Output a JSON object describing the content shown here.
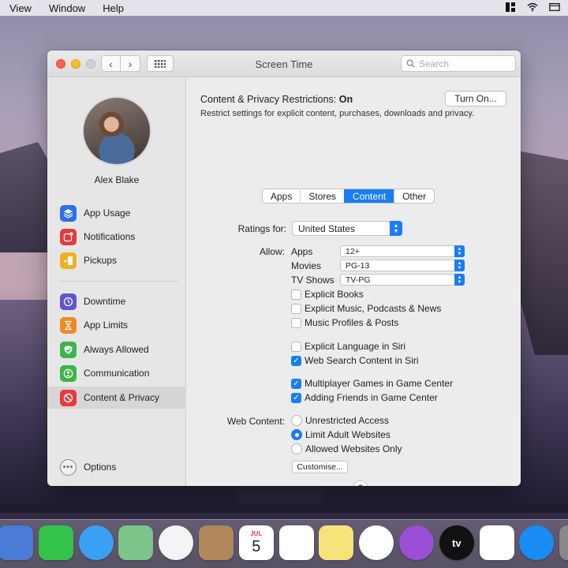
{
  "menubar": {
    "items": [
      "View",
      "Window",
      "Help"
    ]
  },
  "window": {
    "title": "Screen Time",
    "search_placeholder": "Search"
  },
  "sidebar": {
    "user_name": "Alex Blake",
    "items": [
      {
        "label": "App Usage",
        "icon": "stack-icon",
        "color": "#2c6fe8"
      },
      {
        "label": "Notifications",
        "icon": "notification-badge-icon",
        "color": "#e63b3b"
      },
      {
        "label": "Pickups",
        "icon": "phone-pickup-icon",
        "color": "#f0b022"
      },
      {
        "label": "Downtime",
        "icon": "moon-clock-icon",
        "color": "#6155cf"
      },
      {
        "label": "App Limits",
        "icon": "hourglass-icon",
        "color": "#f08a24"
      },
      {
        "label": "Always Allowed",
        "icon": "checkmark-shield-icon",
        "color": "#3bb54a"
      },
      {
        "label": "Communication",
        "icon": "person-circle-icon",
        "color": "#3bb54a"
      },
      {
        "label": "Content & Privacy",
        "icon": "no-entry-icon",
        "color": "#e63b3b"
      }
    ],
    "options_label": "Options"
  },
  "main": {
    "restrictions_label": "Content & Privacy Restrictions:",
    "restrictions_state": "On",
    "restrictions_desc": "Restrict settings for explicit content, purchases, downloads and privacy.",
    "turn_on_label": "Turn On...",
    "tabs": [
      "Apps",
      "Stores",
      "Content",
      "Other"
    ],
    "selected_tab": "Content",
    "ratings_label": "Ratings for:",
    "ratings_value": "United States",
    "allow_label": "Allow:",
    "allow_rows": [
      {
        "label": "Apps",
        "value": "12+"
      },
      {
        "label": "Movies",
        "value": "PG-13"
      },
      {
        "label": "TV Shows",
        "value": "TV-PG"
      }
    ],
    "checkboxes": [
      {
        "label": "Explicit Books",
        "checked": false
      },
      {
        "label": "Explicit Music, Podcasts & News",
        "checked": false
      },
      {
        "label": "Music Profiles & Posts",
        "checked": false
      },
      {
        "label": "Explicit Language in Siri",
        "checked": false
      },
      {
        "label": "Web Search Content in Siri",
        "checked": true
      },
      {
        "label": "Multiplayer Games in Game Center",
        "checked": true
      },
      {
        "label": "Adding Friends in Game Center",
        "checked": true
      }
    ],
    "web_content_label": "Web Content:",
    "web_options": [
      {
        "label": "Unrestricted Access",
        "selected": false
      },
      {
        "label": "Limit Adult Websites",
        "selected": true
      },
      {
        "label": "Allowed Websites Only",
        "selected": false
      }
    ],
    "customise_label": "Customise...",
    "help_label": "?"
  },
  "dock": {
    "calendar_month": "JUL",
    "calendar_day": "5",
    "tv_label": "tv",
    "icons": [
      {
        "name": "mail-icon",
        "color": "#4a7bd6"
      },
      {
        "name": "facetime-icon",
        "color": "#34c34a"
      },
      {
        "name": "messages-icon",
        "color": "#3aa0f5"
      },
      {
        "name": "maps-icon",
        "color": "#7dc48a"
      },
      {
        "name": "photos-icon",
        "color": "#f4f4f4"
      },
      {
        "name": "contacts-icon",
        "color": "#b0875a"
      },
      {
        "name": "calendar-icon",
        "color": "#ffffff"
      },
      {
        "name": "reminders-icon",
        "color": "#ffffff"
      },
      {
        "name": "notes-icon",
        "color": "#f8e27a"
      },
      {
        "name": "music-icon",
        "color": "#ffffff"
      },
      {
        "name": "podcasts-icon",
        "color": "#9b4fd8"
      },
      {
        "name": "apple-tv-icon",
        "color": "#111111"
      },
      {
        "name": "news-icon",
        "color": "#ffffff"
      },
      {
        "name": "app-store-icon",
        "color": "#1a8cf5"
      },
      {
        "name": "system-preferences-icon",
        "color": "#888888"
      }
    ]
  }
}
